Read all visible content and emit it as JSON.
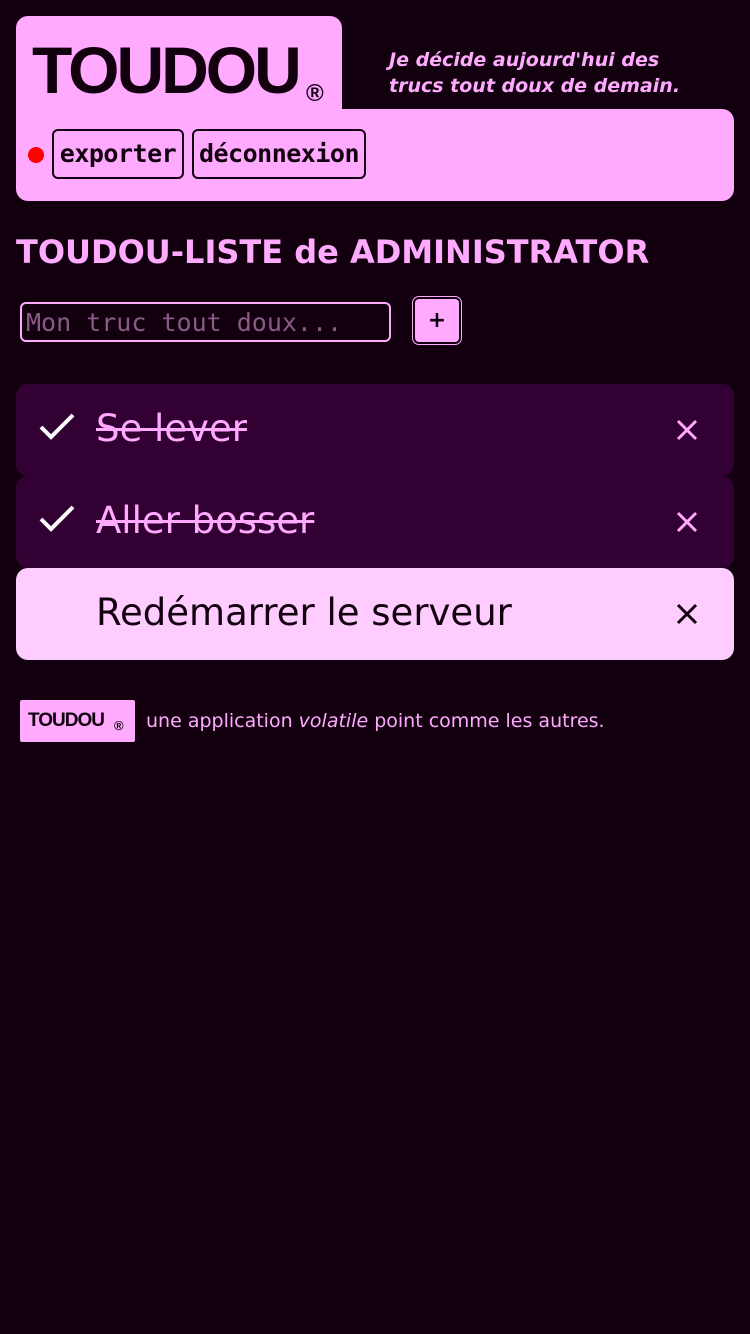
{
  "header": {
    "logo": "TOUDOU",
    "logo_mark": "®",
    "tagline_line1": "Je décide aujourd'hui des",
    "tagline_line2": "trucs tout doux de demain."
  },
  "toolbar": {
    "status": "red-dot",
    "export_label": "exporter",
    "logout_label": "déconnexion"
  },
  "list": {
    "title": "TOUDOU-LISTE de ADMINISTRATOR",
    "new_item_placeholder": "Mon truc tout doux...",
    "new_item_value": "",
    "add_label": "+",
    "items": [
      {
        "label": "Se lever",
        "done": true,
        "check_icon": "check-icon",
        "delete_icon": "close-icon"
      },
      {
        "label": "Aller bosser",
        "done": true,
        "check_icon": "check-icon",
        "delete_icon": "close-icon"
      },
      {
        "label": "Redémarrer le serveur",
        "done": false,
        "delete_icon": "close-icon"
      }
    ]
  },
  "footer": {
    "logo": "TOUDOU",
    "logo_mark": "®",
    "text_before": "une application ",
    "text_emphasis": "volatile",
    "text_after": " point comme les autres."
  },
  "colors": {
    "background": "#12000f",
    "accent": "#ffaaff",
    "done_item_bg": "#330033",
    "pending_item_bg": "#ffccff",
    "status_dot": "#ff0000"
  }
}
